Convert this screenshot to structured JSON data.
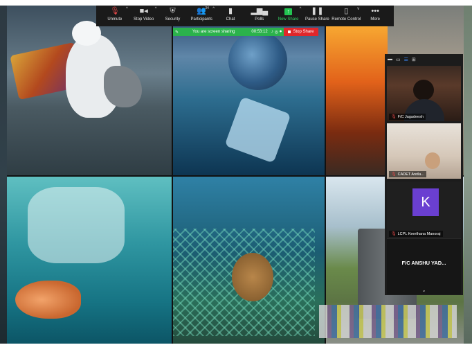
{
  "toolbar": {
    "items": [
      {
        "label": "Unmute",
        "icon": "mic-muted-icon"
      },
      {
        "label": "Stop Video",
        "icon": "video-camera-icon"
      },
      {
        "label": "Security",
        "icon": "shield-icon"
      },
      {
        "label": "Participants",
        "icon": "participants-icon",
        "count": "34"
      },
      {
        "label": "Chat",
        "icon": "chat-icon"
      },
      {
        "label": "Polls",
        "icon": "polls-icon"
      },
      {
        "label": "New Share",
        "icon": "share-arrow-icon"
      },
      {
        "label": "Pause Share",
        "icon": "pause-icon"
      },
      {
        "label": "Remote Control",
        "icon": "mouse-icon"
      },
      {
        "label": "More",
        "icon": "more-dots-icon"
      }
    ]
  },
  "share_banner": {
    "status": "You are screen sharing",
    "timer": "00:53:12",
    "stop_label": "Stop Share"
  },
  "participants": [
    {
      "name": "F/C Jagadeesh"
    },
    {
      "name": "CADET Anrila..."
    },
    {
      "name": "LCPL Keerthana Manoraj",
      "initial": "K"
    },
    {
      "name": "F/C ANSHU YAD..."
    }
  ],
  "colors": {
    "share_green": "#2bb24c",
    "stop_red": "#e0272b",
    "avatar_purple": "#6a3fd1",
    "toolbar_bg": "#1a1a1a"
  }
}
